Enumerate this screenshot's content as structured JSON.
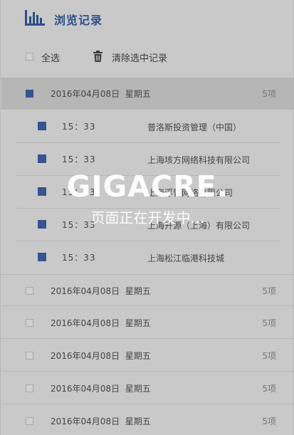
{
  "header": {
    "title": "浏览记录",
    "icon": "bar-chart-icon"
  },
  "toolbar": {
    "select_all": "全选",
    "clear_selected": "清除选中记录",
    "trash_icon": "trash-icon"
  },
  "groups": [
    {
      "date": "2016年04月08日",
      "weekday": "星期五",
      "count": "5项",
      "checked": true,
      "items": [
        {
          "time": "15：33",
          "name": "普洛斯投资管理（中国）"
        },
        {
          "time": "15：33",
          "name": "上海垓方网络科技有限公司"
        },
        {
          "time": "15：33",
          "name": "上海浮管网络有限公司"
        },
        {
          "time": "15：33",
          "name": "上海开源（上海）有限公司"
        },
        {
          "time": "15：33",
          "name": "上海松江临港科技城"
        }
      ]
    },
    {
      "date": "2016年04月08日",
      "weekday": "星期五",
      "count": "5项",
      "checked": false
    },
    {
      "date": "2016年04月08日",
      "weekday": "星期五",
      "count": "5项",
      "checked": false
    },
    {
      "date": "2016年04月08日",
      "weekday": "星期五",
      "count": "5项",
      "checked": false
    },
    {
      "date": "2016年04月08日",
      "weekday": "星期五",
      "count": "5项",
      "checked": false
    },
    {
      "date": "2016年04月08日",
      "weekday": "星期五",
      "count": "5项",
      "checked": false
    }
  ],
  "watermark": {
    "title": "GIGACRE.",
    "subtitle": "页面正在开发中…"
  },
  "colors": {
    "accent": "#2d4f87",
    "checkbox_checked": "#34558f",
    "background": "#c9c9c9",
    "active_row": "#b6b6b6"
  }
}
